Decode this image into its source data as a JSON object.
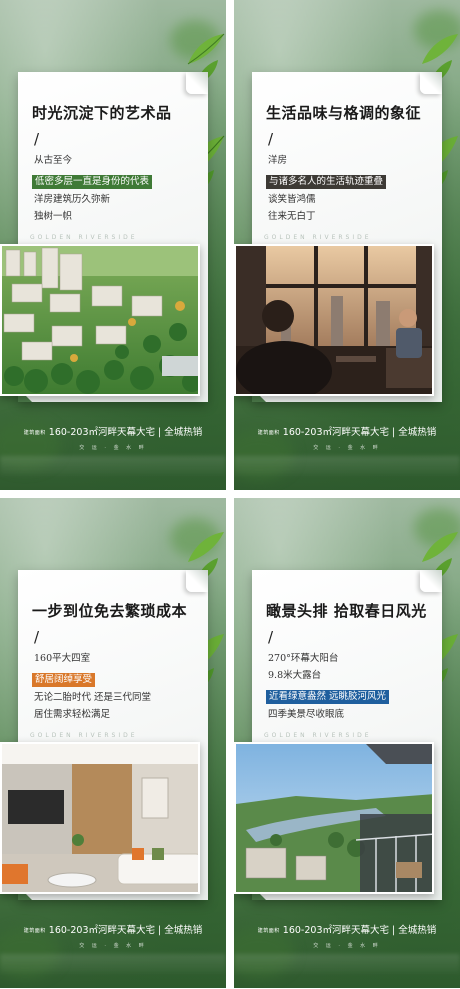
{
  "posters": [
    {
      "headline": "时光沉淀下的艺术品",
      "slash": "/",
      "lines": [
        {
          "text": "从古至今",
          "highlight": false
        },
        {
          "text": "低密多层一直是身份的代表",
          "highlight": true,
          "color": "#3f7a36"
        },
        {
          "text": "洋房建筑历久弥新",
          "highlight": false
        },
        {
          "text": "独树一帜",
          "highlight": false
        }
      ],
      "watermark": "GOLDEN RIVERSIDE",
      "photo_subject": "aerial-residential-buildings"
    },
    {
      "headline": "生活品味与格调的象征",
      "slash": "/",
      "lines": [
        {
          "text": "洋房",
          "highlight": false
        },
        {
          "text": "与诸多名人的生活轨迹重叠",
          "highlight": true,
          "color": "#3d3a35"
        },
        {
          "text": "谈笑皆鸿儒",
          "highlight": false
        },
        {
          "text": "往来无白丁",
          "highlight": false
        }
      ],
      "watermark": "GOLDEN RIVERSIDE",
      "photo_subject": "businessmen-meeting"
    },
    {
      "headline": "一步到位免去繁琐成本",
      "slash": "/",
      "lines": [
        {
          "text": "160平大四室",
          "highlight": false
        },
        {
          "text": "舒居阔绰享受",
          "highlight": true,
          "color": "#d9782a"
        },
        {
          "text": "无论二胎时代 还是三代同堂",
          "highlight": false
        },
        {
          "text": "居住需求轻松满足",
          "highlight": false
        }
      ],
      "watermark": "GOLDEN RIVERSIDE",
      "photo_subject": "living-room-interior"
    },
    {
      "headline": "瞰景头排 拾取春日风光",
      "slash": "/",
      "lines": [
        {
          "text": "270°环幕大阳台",
          "highlight": false
        },
        {
          "text": "9.8米大露台",
          "highlight": false
        },
        {
          "text": "近看绿意盎然 远眺胶河风光",
          "highlight": true,
          "color": "#1f5f9e"
        },
        {
          "text": "四季美景尽收眼底",
          "highlight": false
        }
      ],
      "watermark": "GOLDEN RIVERSIDE",
      "photo_subject": "balcony-river-view"
    }
  ],
  "footer": {
    "prefix": "建筑面积",
    "text": "160-203㎡河畔天幕大宅 | 全城热销",
    "sub": "交 运 · 金 水 畔"
  }
}
